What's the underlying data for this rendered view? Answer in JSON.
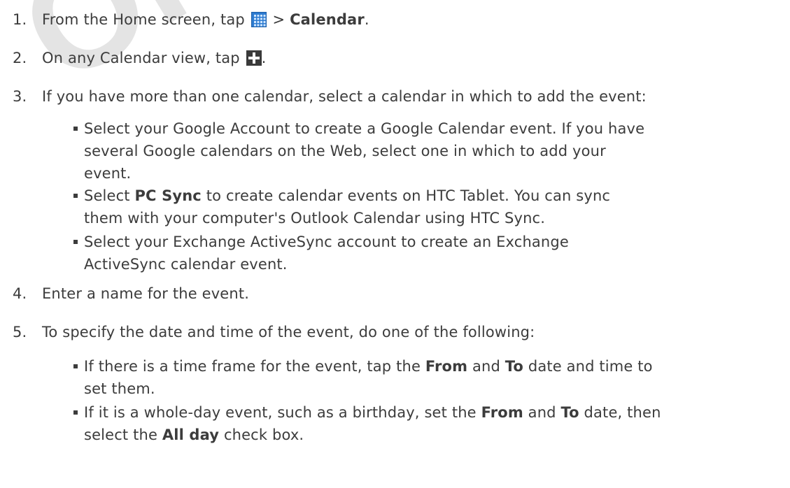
{
  "watermark": "Only for",
  "steps": [
    {
      "num": "1.",
      "parts": [
        "From the Home screen, tap ",
        " > ",
        "Calendar",
        "."
      ],
      "icon": "all-apps-grid-icon"
    },
    {
      "num": "2.",
      "parts": [
        "On any Calendar view, tap ",
        "."
      ],
      "icon": "add-plus-icon"
    },
    {
      "num": "3.",
      "text": "If you have more than one calendar, select a calendar in which to add the event:",
      "bullets": [
        {
          "lines": [
            "Select your Google Account to create a Google Calendar event. If you have",
            "several Google calendars on the Web, select one in which to add your",
            "event."
          ]
        },
        {
          "parts": [
            "Select ",
            "PC Sync",
            " to create calendar events on HTC Tablet. You can sync"
          ],
          "line2": "them with your computer's Outlook Calendar using HTC Sync."
        },
        {
          "lines": [
            "Select your Exchange ActiveSync account to create an Exchange",
            "ActiveSync calendar event."
          ]
        }
      ]
    },
    {
      "num": "4.",
      "text": "Enter a name for the event."
    },
    {
      "num": "5.",
      "text": "To specify the date and time of the event, do one of the following:",
      "bullets": [
        {
          "parts": [
            "If there is a time frame for the event, tap the ",
            "From",
            " and ",
            "To",
            " date and time to"
          ],
          "line2": "set them."
        },
        {
          "parts": [
            "If it is a whole-day event, such as a birthday, set the ",
            "From",
            " and ",
            "To",
            " date, then"
          ],
          "line2parts": [
            "select the ",
            "All day",
            " check box."
          ]
        }
      ]
    }
  ]
}
